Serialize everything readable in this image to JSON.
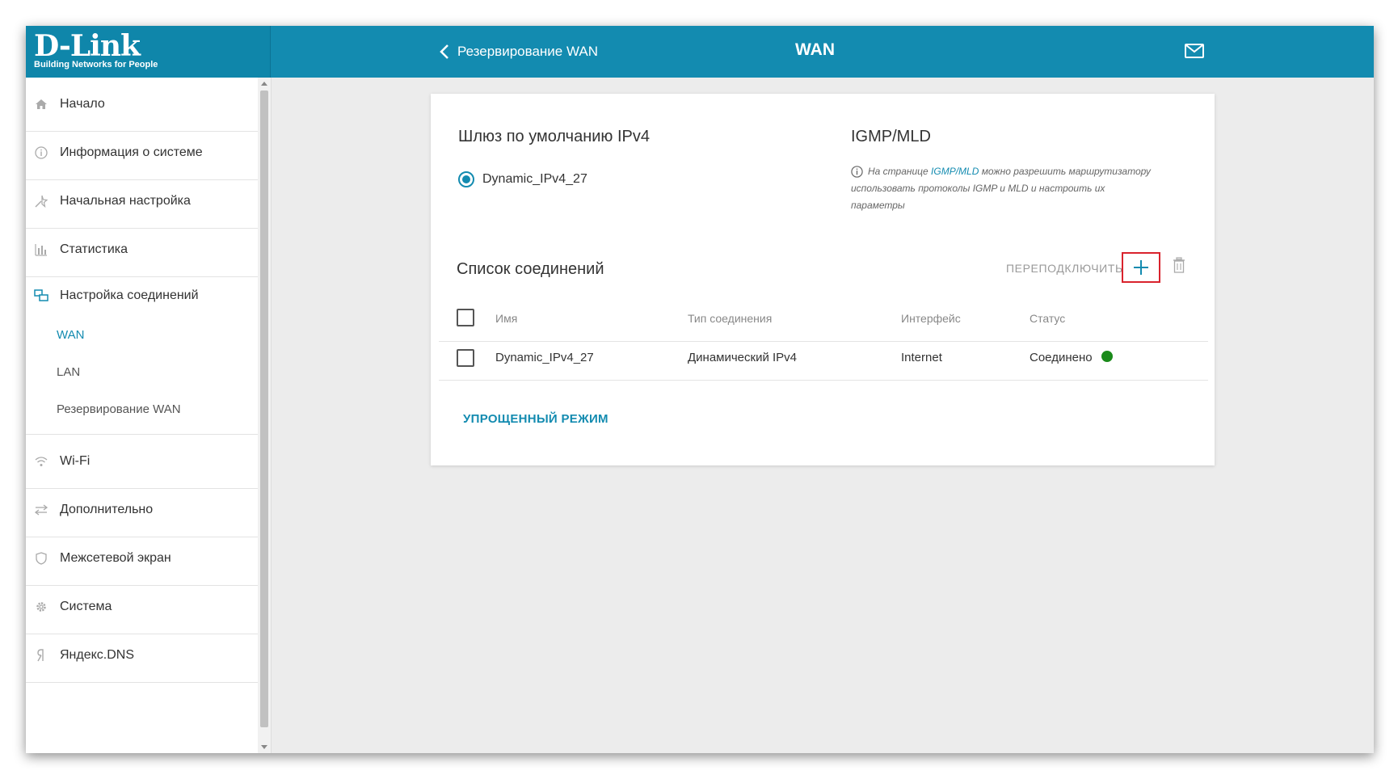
{
  "header": {
    "logo_text": "D-Link",
    "logo_tagline": "Building Networks for People",
    "back_label": "Резервирование WAN",
    "title": "WAN"
  },
  "sidebar": {
    "items": [
      {
        "label": "Начало",
        "icon": "home-icon"
      },
      {
        "label": "Информация о системе",
        "icon": "info-icon"
      },
      {
        "label": "Начальная настройка",
        "icon": "wizard-icon"
      },
      {
        "label": "Статистика",
        "icon": "bar-chart-icon"
      },
      {
        "label": "Настройка соединений",
        "icon": "connections-icon"
      },
      {
        "label": "Wi-Fi",
        "icon": "wifi-icon"
      },
      {
        "label": "Дополнительно",
        "icon": "arrows-icon"
      },
      {
        "label": "Межсетевой экран",
        "icon": "shield-icon"
      },
      {
        "label": "Система",
        "icon": "gear-icon"
      },
      {
        "label": "Яндекс.DNS",
        "icon": "yandex-icon"
      }
    ],
    "sub_items": [
      "WAN",
      "LAN",
      "Резервирование WAN"
    ]
  },
  "gateway": {
    "title": "Шлюз по умолчанию IPv4",
    "selected": "Dynamic_IPv4_27"
  },
  "igmp": {
    "title": "IGMP/MLD",
    "note_before": "На странице ",
    "note_link": "IGMP/MLD",
    "note_after": " можно разрешить маршрутизатору использовать протоколы IGMP и MLD и настроить их параметры"
  },
  "connections": {
    "title": "Список соединений",
    "reconnect_label": "ПЕРЕПОДКЛЮЧИТЬ",
    "columns": [
      "Имя",
      "Тип соединения",
      "Интерфейс",
      "Статус"
    ],
    "rows": [
      {
        "name": "Dynamic_IPv4_27",
        "type": "Динамический IPv4",
        "interface": "Internet",
        "status": "Соединено",
        "status_color": "#1a8a1a"
      }
    ]
  },
  "simple_mode_label": "УПРОЩЕННЫЙ РЕЖИМ",
  "colors": {
    "accent": "#138bb0",
    "highlight": "#d9232d"
  }
}
